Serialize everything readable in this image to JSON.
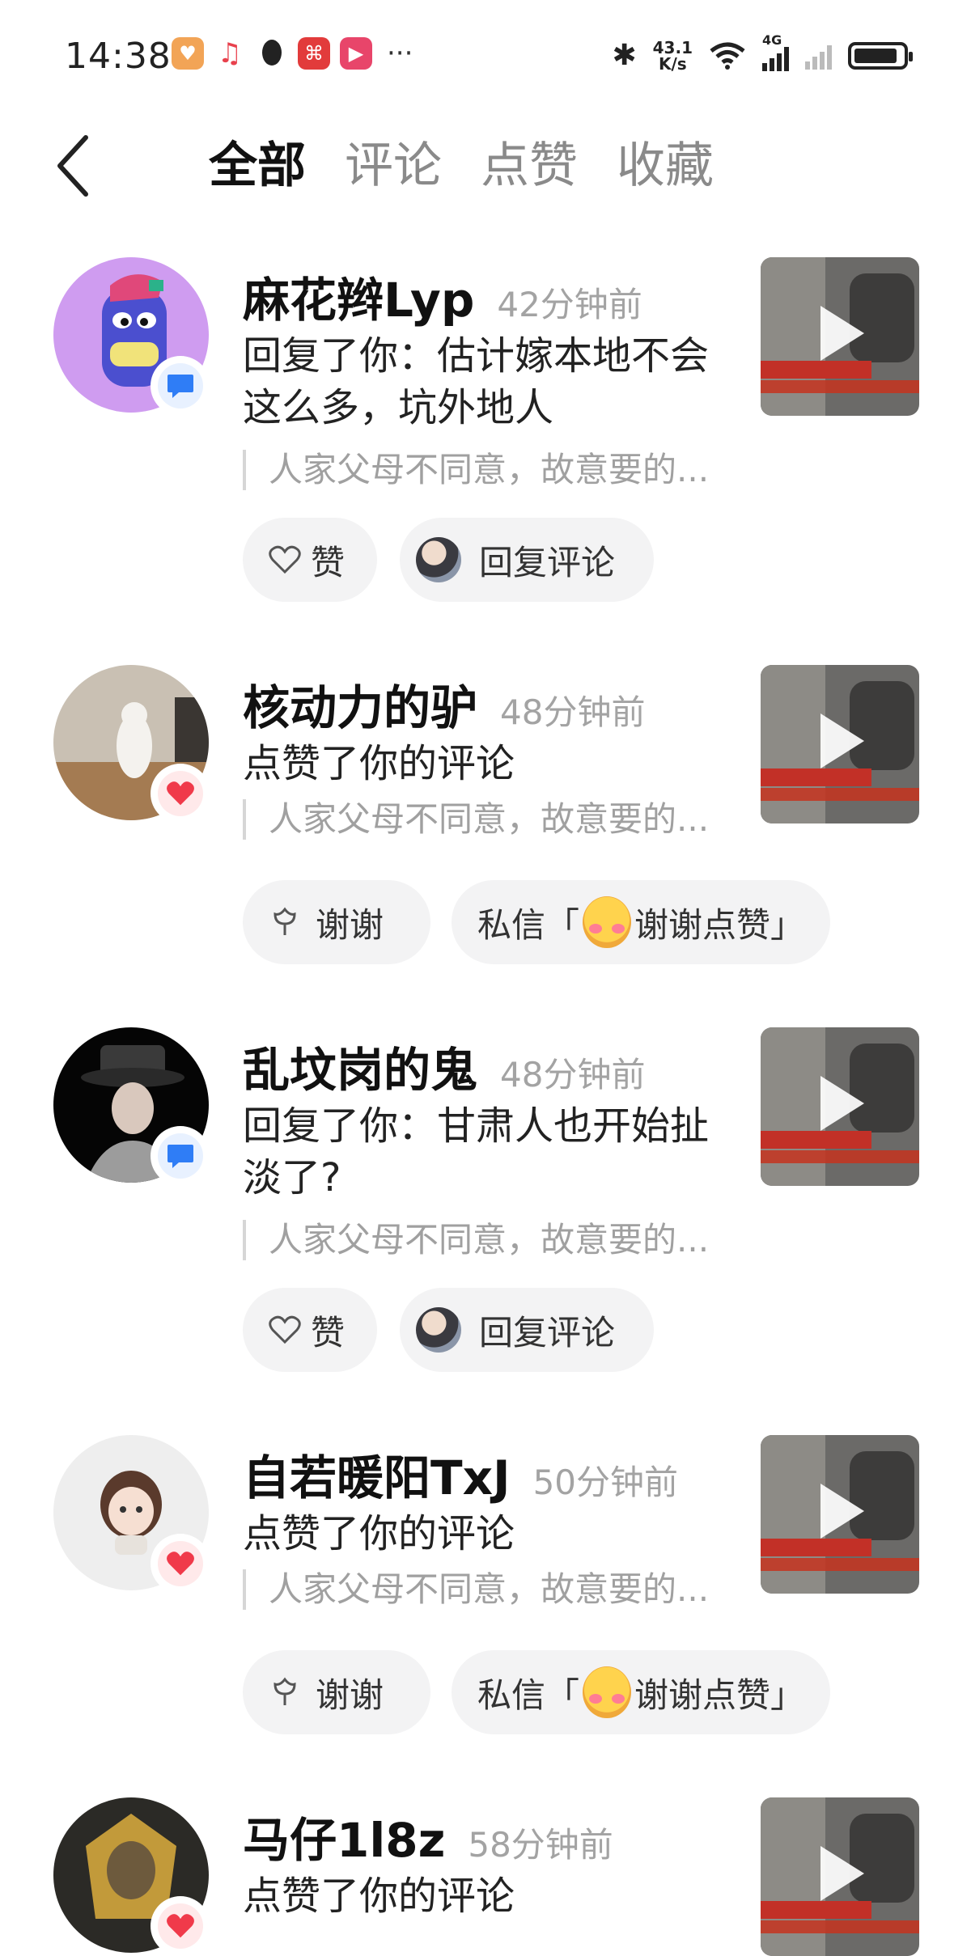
{
  "status_bar": {
    "time": "14:38",
    "speed_value": "43.1",
    "speed_unit": "K/s",
    "network": "4G"
  },
  "tabs": [
    {
      "label": "全部",
      "active": true
    },
    {
      "label": "评论",
      "active": false
    },
    {
      "label": "点赞",
      "active": false
    },
    {
      "label": "收藏",
      "active": false
    }
  ],
  "notifications": [
    {
      "type": "reply",
      "name": "麻花辫Lyp",
      "time": "42分钟前",
      "action": "回复了你：估计嫁本地不会这么多，坑外地人",
      "quote": "人家父母不同意，故意要的...",
      "btn1": "赞",
      "btn2": "回复评论",
      "badge_icon": "chat-bubble-icon"
    },
    {
      "type": "like",
      "name": "核动力的驴",
      "time": "48分钟前",
      "action": "点赞了你的评论",
      "quote": "人家父母不同意，故意要的...",
      "btn1": "谢谢",
      "btn2_prefix": "私信「",
      "btn2_suffix": "谢谢点赞」",
      "badge_icon": "heart-icon"
    },
    {
      "type": "reply",
      "name": "乱坟岗的鬼",
      "time": "48分钟前",
      "action": "回复了你：甘肃人也开始扯淡了?",
      "quote": "人家父母不同意，故意要的...",
      "btn1": "赞",
      "btn2": "回复评论",
      "badge_icon": "chat-bubble-icon"
    },
    {
      "type": "like",
      "name": "自若暖阳TxJ",
      "time": "50分钟前",
      "action": "点赞了你的评论",
      "quote": "人家父母不同意，故意要的...",
      "btn1": "谢谢",
      "btn2_prefix": "私信「",
      "btn2_suffix": "谢谢点赞」",
      "badge_icon": "heart-icon"
    },
    {
      "type": "like",
      "name": "马仔1l8z",
      "time": "58分钟前",
      "action": "点赞了你的评论",
      "badge_icon": "heart-icon"
    }
  ],
  "colors": {
    "accent_blue": "#2f7df6",
    "accent_red": "#f03a4a",
    "muted_text": "#a3a3a3"
  }
}
